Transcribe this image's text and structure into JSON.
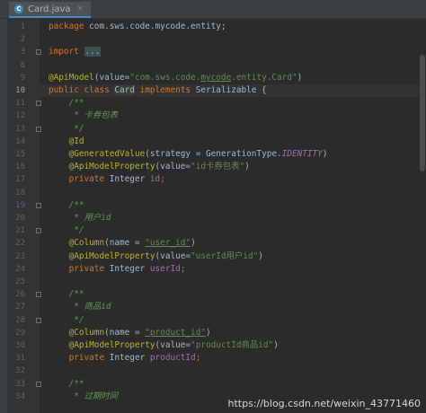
{
  "tab": {
    "filename": "Card.java",
    "icon": "class-icon",
    "icon_glyph": "C",
    "close_glyph": "×"
  },
  "editor": {
    "current_line": 10,
    "lines": [
      {
        "n": "1",
        "tokens": [
          [
            "kw",
            "package "
          ],
          [
            "",
            "com.sws.code.mycode.entity;"
          ]
        ]
      },
      {
        "n": "2",
        "tokens": []
      },
      {
        "n": "3",
        "tokens": [
          [
            "kw",
            "import "
          ],
          [
            "folded",
            "..."
          ]
        ]
      },
      {
        "n": "8",
        "tokens": []
      },
      {
        "n": "9",
        "tokens": [
          [
            "ann",
            "@ApiModel"
          ],
          [
            "",
            "(value="
          ],
          [
            "str",
            "\"com.sws.code."
          ],
          [
            "str ul",
            "mycode"
          ],
          [
            "str",
            ".entity.Card\""
          ],
          [
            "",
            ")"
          ]
        ]
      },
      {
        "n": "10",
        "tokens": [
          [
            "kw",
            "public class "
          ],
          [
            "cls-hl",
            "Card"
          ],
          [
            "kw",
            " implements "
          ],
          [
            "",
            "Serializable {"
          ]
        ]
      },
      {
        "n": "11",
        "tokens": [
          [
            "cmt",
            "    /**"
          ]
        ]
      },
      {
        "n": "12",
        "tokens": [
          [
            "cmt",
            "     * 卡券包表"
          ]
        ]
      },
      {
        "n": "13",
        "tokens": [
          [
            "cmt",
            "     */"
          ]
        ]
      },
      {
        "n": "14",
        "tokens": [
          [
            "ann",
            "    @Id"
          ]
        ]
      },
      {
        "n": "15",
        "tokens": [
          [
            "ann",
            "    @GeneratedValue"
          ],
          [
            "",
            "(strategy = GenerationType."
          ],
          [
            "const",
            "IDENTITY"
          ],
          [
            "",
            ")"
          ]
        ]
      },
      {
        "n": "16",
        "tokens": [
          [
            "ann",
            "    @ApiModelProperty"
          ],
          [
            "",
            "(value="
          ],
          [
            "str",
            "\"id卡券包表\""
          ],
          [
            "",
            ")"
          ]
        ]
      },
      {
        "n": "17",
        "tokens": [
          [
            "kw",
            "    private "
          ],
          [
            "",
            "Integer "
          ],
          [
            "fld",
            "id"
          ],
          [
            "kw",
            ";"
          ]
        ]
      },
      {
        "n": "18",
        "tokens": []
      },
      {
        "n": "19",
        "tokens": [
          [
            "cmt",
            "    /**"
          ]
        ]
      },
      {
        "n": "20",
        "tokens": [
          [
            "cmt",
            "     * 用户id"
          ]
        ]
      },
      {
        "n": "21",
        "tokens": [
          [
            "cmt",
            "     */"
          ]
        ]
      },
      {
        "n": "22",
        "tokens": [
          [
            "ann",
            "    @Column"
          ],
          [
            "",
            "(name = "
          ],
          [
            "str ul",
            "\"user_id\""
          ],
          [
            "",
            ")"
          ]
        ]
      },
      {
        "n": "23",
        "tokens": [
          [
            "ann",
            "    @ApiModelProperty"
          ],
          [
            "",
            "(value="
          ],
          [
            "str",
            "\"userId用户id\""
          ],
          [
            "",
            ")"
          ]
        ]
      },
      {
        "n": "24",
        "tokens": [
          [
            "kw",
            "    private "
          ],
          [
            "",
            "Integer "
          ],
          [
            "fld",
            "userId"
          ],
          [
            "kw",
            ";"
          ]
        ]
      },
      {
        "n": "25",
        "tokens": []
      },
      {
        "n": "26",
        "tokens": [
          [
            "cmt",
            "    /**"
          ]
        ]
      },
      {
        "n": "27",
        "tokens": [
          [
            "cmt",
            "     * 商品id"
          ]
        ]
      },
      {
        "n": "28",
        "tokens": [
          [
            "cmt",
            "     */"
          ]
        ]
      },
      {
        "n": "29",
        "tokens": [
          [
            "ann",
            "    @Column"
          ],
          [
            "",
            "(name = "
          ],
          [
            "str ul",
            "\"product_id\""
          ],
          [
            "",
            ")"
          ]
        ]
      },
      {
        "n": "30",
        "tokens": [
          [
            "ann",
            "    @ApiModelProperty"
          ],
          [
            "",
            "(value="
          ],
          [
            "str",
            "\"productId商品id\""
          ],
          [
            "",
            ")"
          ]
        ]
      },
      {
        "n": "31",
        "tokens": [
          [
            "kw",
            "    private "
          ],
          [
            "",
            "Integer "
          ],
          [
            "fld",
            "productId"
          ],
          [
            "kw",
            ";"
          ]
        ]
      },
      {
        "n": "32",
        "tokens": []
      },
      {
        "n": "33",
        "tokens": [
          [
            "cmt",
            "    /**"
          ]
        ]
      },
      {
        "n": "34",
        "tokens": [
          [
            "cmt",
            "     * 过期时间"
          ]
        ]
      }
    ]
  },
  "watermark": "https://blog.csdn.net/weixin_43771460"
}
